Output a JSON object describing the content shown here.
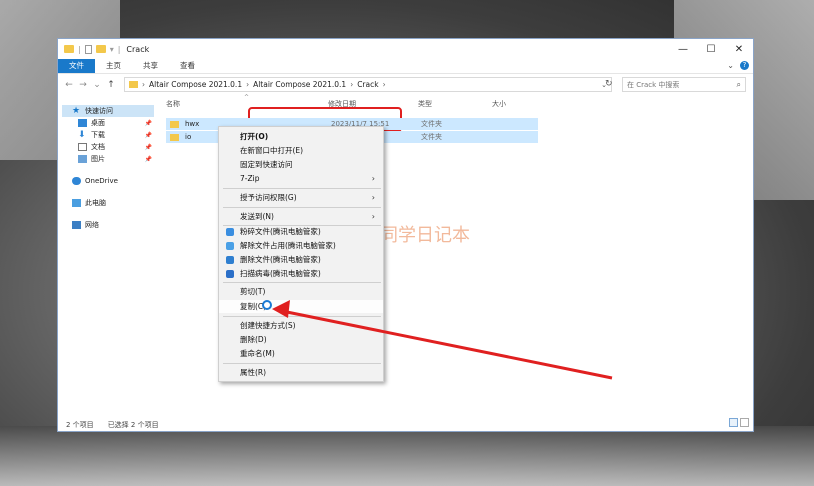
{
  "window": {
    "title": "Crack"
  },
  "ribbon": {
    "tabs": [
      "文件",
      "主页",
      "共享",
      "查看"
    ]
  },
  "nav": {
    "breadcrumb": [
      "Altair Compose 2021.0.1",
      "Altair Compose 2021.0.1",
      "Crack"
    ],
    "search_placeholder": "在 Crack 中搜索"
  },
  "sidebar": {
    "items": [
      {
        "label": "快速访问",
        "icon": "star-icon"
      },
      {
        "label": "桌面",
        "icon": "desktop-icon"
      },
      {
        "label": "下载",
        "icon": "download-icon"
      },
      {
        "label": "文档",
        "icon": "document-icon"
      },
      {
        "label": "图片",
        "icon": "picture-icon"
      },
      {
        "label": "OneDrive",
        "icon": "cloud-icon"
      },
      {
        "label": "此电脑",
        "icon": "computer-icon"
      },
      {
        "label": "网络",
        "icon": "network-icon"
      }
    ]
  },
  "columns": [
    "名称",
    "修改日期",
    "类型",
    "大小"
  ],
  "files": [
    {
      "name": "hwx",
      "date": "2023/11/7 15:51",
      "type": "文件夹"
    },
    {
      "name": "io",
      "date": "",
      "type": "文件夹"
    }
  ],
  "status": {
    "count": "2 个项目",
    "selected": "已选择 2 个项目"
  },
  "context_menu": [
    {
      "label": "打开(O)",
      "bold": true
    },
    {
      "label": "在新窗口中打开(E)"
    },
    {
      "label": "固定到快速访问"
    },
    {
      "label": "7-Zip",
      "submenu": true
    },
    {
      "label": "授予访问权限(G)",
      "submenu": true
    },
    {
      "label": "发送到(N)",
      "submenu": true
    },
    {
      "label": "粉碎文件(腾讯电脑管家)",
      "icon": "shred-icon"
    },
    {
      "label": "解除文件占用(腾讯电脑管家)",
      "icon": "unlock-icon"
    },
    {
      "label": "删除文件(腾讯电脑管家)",
      "icon": "delete-icon"
    },
    {
      "label": "扫描病毒(腾讯电脑管家)",
      "icon": "shield-icon"
    },
    {
      "label": "剪切(T)"
    },
    {
      "label": "复制(C)"
    },
    {
      "label": "创建快捷方式(S)"
    },
    {
      "label": "删除(D)"
    },
    {
      "label": "重命名(M)"
    },
    {
      "label": "属性(R)"
    }
  ],
  "watermark": {
    "text": "丁同学日记本"
  },
  "colors": {
    "accent": "#1979ca",
    "highlight": "#e02020",
    "selection": "#cce8ff",
    "folder": "#f3c84b"
  }
}
